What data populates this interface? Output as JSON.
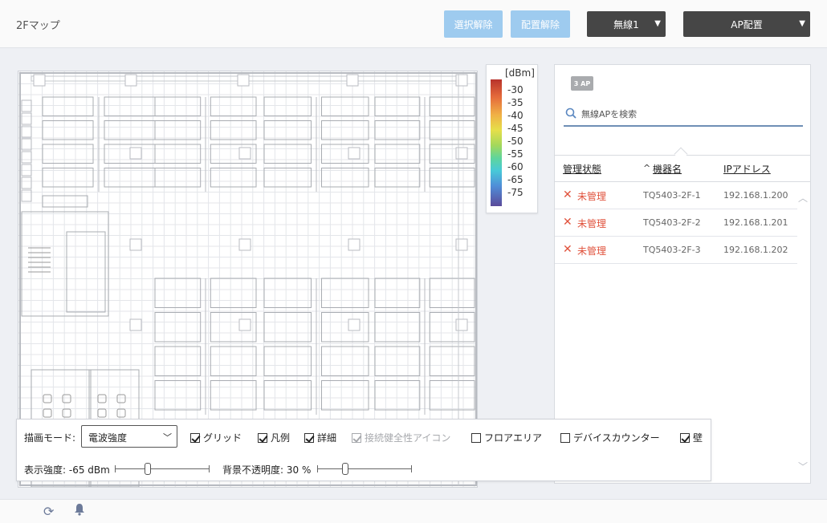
{
  "header": {
    "title": "2Fマップ",
    "deselect_label": "選択解除",
    "unplace_label": "配置解除",
    "radio_select": "無線1",
    "ap_place_select": "AP配置"
  },
  "legend": {
    "unit": "[dBm]",
    "values": [
      "-30",
      "-35",
      "-40",
      "-45",
      "-50",
      "-55",
      "-60",
      "-65",
      "-75"
    ]
  },
  "ap_panel": {
    "count_badge": "3 AP",
    "search_placeholder": "無線APを検索",
    "columns": {
      "status": "管理状態",
      "sort_indicator": "^",
      "name": "機器名",
      "ip": "IPアドレス"
    },
    "rows": [
      {
        "status": "未管理",
        "name": "TQ5403-2F-1",
        "ip": "192.168.1.200"
      },
      {
        "status": "未管理",
        "name": "TQ5403-2F-2",
        "ip": "192.168.1.201"
      },
      {
        "status": "未管理",
        "name": "TQ5403-2F-3",
        "ip": "192.168.1.202"
      }
    ]
  },
  "controls": {
    "draw_mode_label": "描画モード:",
    "draw_mode_value": "電波強度",
    "checkboxes": {
      "grid": {
        "label": "グリッド",
        "checked": true
      },
      "legend": {
        "label": "凡例",
        "checked": true
      },
      "detail": {
        "label": "詳細",
        "checked": true
      },
      "connection_icon": {
        "label": "接続健全性アイコン",
        "checked": true,
        "disabled": true
      },
      "floor_area": {
        "label": "フロアエリア",
        "checked": false
      },
      "device_counter": {
        "label": "デバイスカウンター",
        "checked": false
      },
      "wall": {
        "label": "壁",
        "checked": true
      }
    },
    "strength_label": "表示強度: -65 dBm",
    "opacity_label": "背景不透明度: 30 %",
    "strength_level": 0.35,
    "opacity_level": 0.3
  },
  "colors": {
    "light_button": "#9ecbef",
    "dark_button": "#464646",
    "unmanaged": "#e0513b",
    "search_underline": "#6f8fb5"
  },
  "icons": {
    "footer": [
      "refresh-icon",
      "bell-icon"
    ]
  }
}
